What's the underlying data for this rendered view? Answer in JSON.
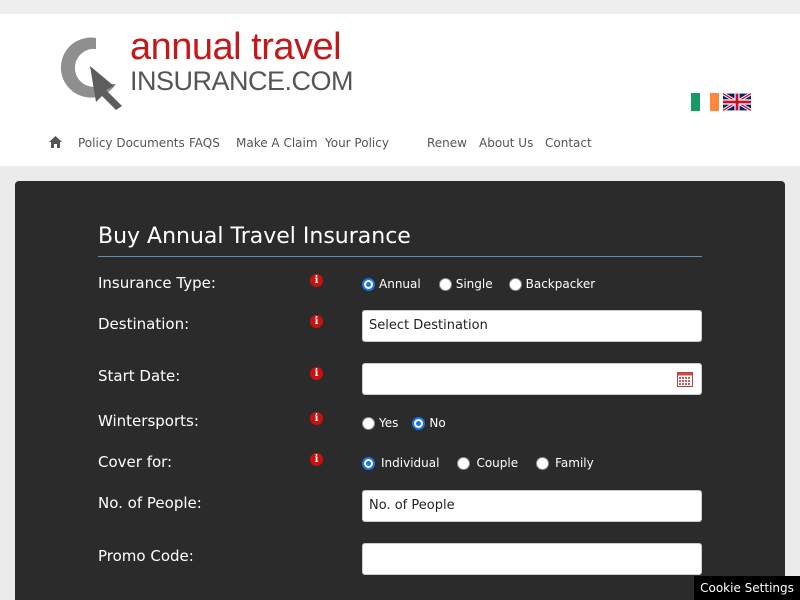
{
  "logo": {
    "line1": "annual travel",
    "line2": "INSURANCE.COM"
  },
  "flags": [
    {
      "name": "ireland",
      "colors": [
        "#169b62",
        "#ffffff",
        "#ff883e"
      ]
    },
    {
      "name": "united-kingdom",
      "colors": [
        "#012169",
        "#ffffff",
        "#c8102e"
      ]
    }
  ],
  "nav": {
    "home_icon": "home-icon",
    "items": [
      "Policy Documents",
      "FAQS",
      "Make A Claim",
      "Your Policy",
      "Renew",
      "About Us",
      "Contact"
    ]
  },
  "form": {
    "title": "Buy Annual Travel Insurance",
    "insurance_type": {
      "label": "Insurance Type:",
      "options": [
        "Annual",
        "Single",
        "Backpacker"
      ],
      "selected": "Annual"
    },
    "destination": {
      "label": "Destination:",
      "value": "Select Destination"
    },
    "start_date": {
      "label": "Start Date:",
      "value": ""
    },
    "wintersports": {
      "label": "Wintersports:",
      "options": [
        "Yes",
        "No"
      ],
      "selected": "No"
    },
    "cover_for": {
      "label": "Cover for:",
      "options": [
        "Individual",
        "Couple",
        "Family"
      ],
      "selected": "Individual"
    },
    "people": {
      "label": "No. of People:",
      "value": "No. of People"
    },
    "promo": {
      "label": "Promo Code:",
      "value": ""
    }
  },
  "cookie": {
    "label": "Cookie Settings"
  },
  "colors": {
    "brand_red": "#c21a1a",
    "panel_bg": "#2b2b2b",
    "radio_blue": "#1a73e8",
    "info_red": "#cc1010"
  }
}
